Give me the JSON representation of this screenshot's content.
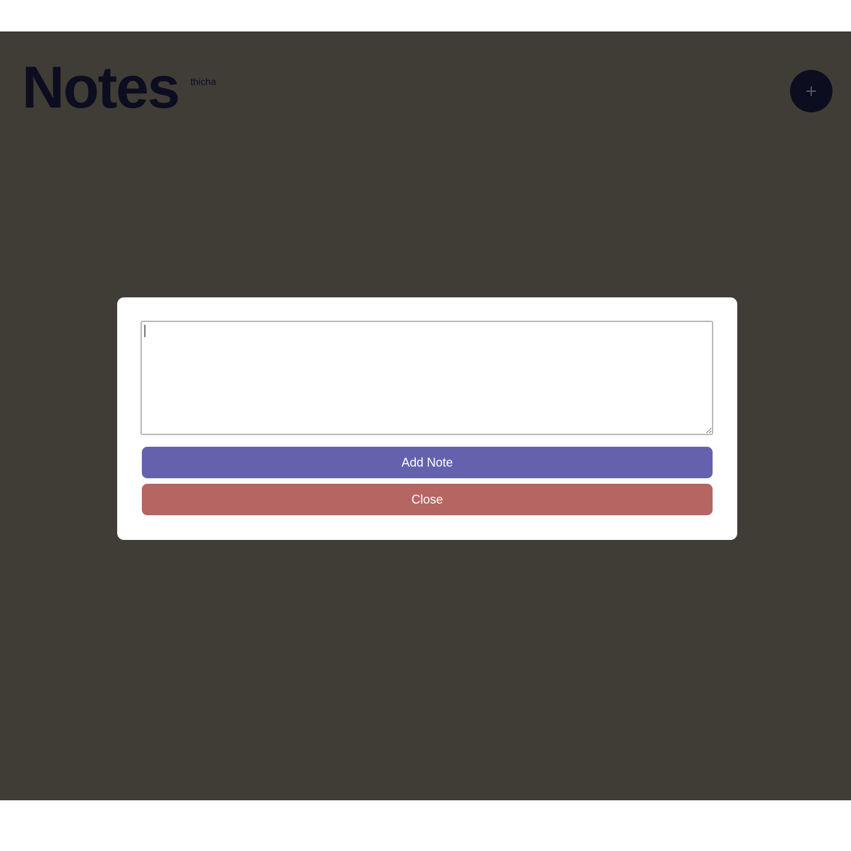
{
  "header": {
    "title": "Notes",
    "user": "thicha",
    "add_button_label": "+"
  },
  "modal": {
    "note_value": "",
    "note_placeholder": "",
    "add_label": "Add Note",
    "close_label": "Close"
  },
  "colors": {
    "overlay": "#403d37",
    "title": "#0c0d1f",
    "add_button": "#6462ad",
    "close_button": "#b56562",
    "fab": "#0c0d1f"
  },
  "icons": {
    "fab": "plus-icon"
  }
}
